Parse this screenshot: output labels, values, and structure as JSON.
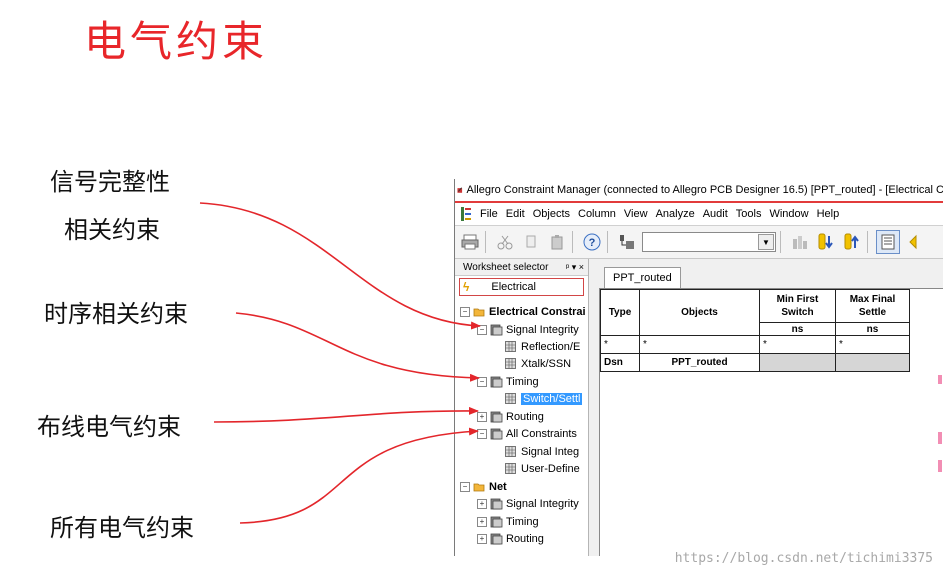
{
  "slide": {
    "title": "电气约束",
    "labels": {
      "signal_integrity": "信号完整性",
      "related": "相关约束",
      "timing": "时序相关约束",
      "routing": "布线电气约束",
      "all": "所有电气约束"
    },
    "arrow_color": "#e3262b",
    "title_color": "#e8262a"
  },
  "app": {
    "title": "Allegro Constraint Manager (connected to Allegro PCB Designer 16.5) [PPT_routed] - [Electrical C",
    "menu": [
      "File",
      "Edit",
      "Objects",
      "Column",
      "View",
      "Analyze",
      "Audit",
      "Tools",
      "Window",
      "Help"
    ],
    "menu_mnemonics": [
      "F",
      "E",
      "O",
      "C",
      "V",
      "n",
      "A",
      "T",
      "W",
      "H"
    ],
    "toolbar_icons": [
      "print-icon",
      "cut-icon",
      "copy-icon",
      "paste-icon",
      "help-icon",
      "filter-icon",
      "combo",
      "flow-icon",
      "prev-icon",
      "next-icon",
      "sheet-icon"
    ],
    "sidebar": {
      "header": "Worksheet selector",
      "header_controls": "ᵖ ▾ ×",
      "electrical": "Electrical",
      "tree": [
        {
          "label": "Electrical Constrai",
          "level": 0,
          "exp": "−",
          "icon": "folder",
          "bold": true
        },
        {
          "label": "Signal Integrity",
          "level": 1,
          "exp": "−",
          "icon": "book"
        },
        {
          "label": "Reflection/E",
          "level": 2,
          "exp": "",
          "icon": "sheet"
        },
        {
          "label": "Xtalk/SSN",
          "level": 2,
          "exp": "",
          "icon": "sheet"
        },
        {
          "label": "Timing",
          "level": 1,
          "exp": "−",
          "icon": "book"
        },
        {
          "label": "Switch/Settl",
          "level": 2,
          "exp": "",
          "icon": "sheet",
          "selected": true
        },
        {
          "label": "Routing",
          "level": 1,
          "exp": "+",
          "icon": "book"
        },
        {
          "label": "All Constraints",
          "level": 1,
          "exp": "−",
          "icon": "book"
        },
        {
          "label": "Signal Integ",
          "level": 2,
          "exp": "",
          "icon": "sheet"
        },
        {
          "label": "User-Define",
          "level": 2,
          "exp": "",
          "icon": "sheet"
        },
        {
          "label": "Net",
          "level": 0,
          "exp": "−",
          "icon": "folder",
          "bold": true
        },
        {
          "label": "Signal Integrity",
          "level": 1,
          "exp": "+",
          "icon": "book"
        },
        {
          "label": "Timing",
          "level": 1,
          "exp": "+",
          "icon": "book"
        },
        {
          "label": "Routing",
          "level": 1,
          "exp": "+",
          "icon": "book"
        }
      ]
    },
    "tab": "PPT_routed",
    "grid": {
      "col_type": "Type",
      "col_objects": "Objects",
      "col_min1": "Min First",
      "col_min2": "Switch",
      "col_max1": "Max Final",
      "col_max2": "Settle",
      "unit_min": "ns",
      "unit_max": "ns",
      "filter_row": [
        "*",
        "*",
        "*",
        "*"
      ],
      "row": [
        "Dsn",
        "PPT_routed",
        "",
        ""
      ]
    }
  },
  "watermark": "https://blog.csdn.net/tichimi3375"
}
